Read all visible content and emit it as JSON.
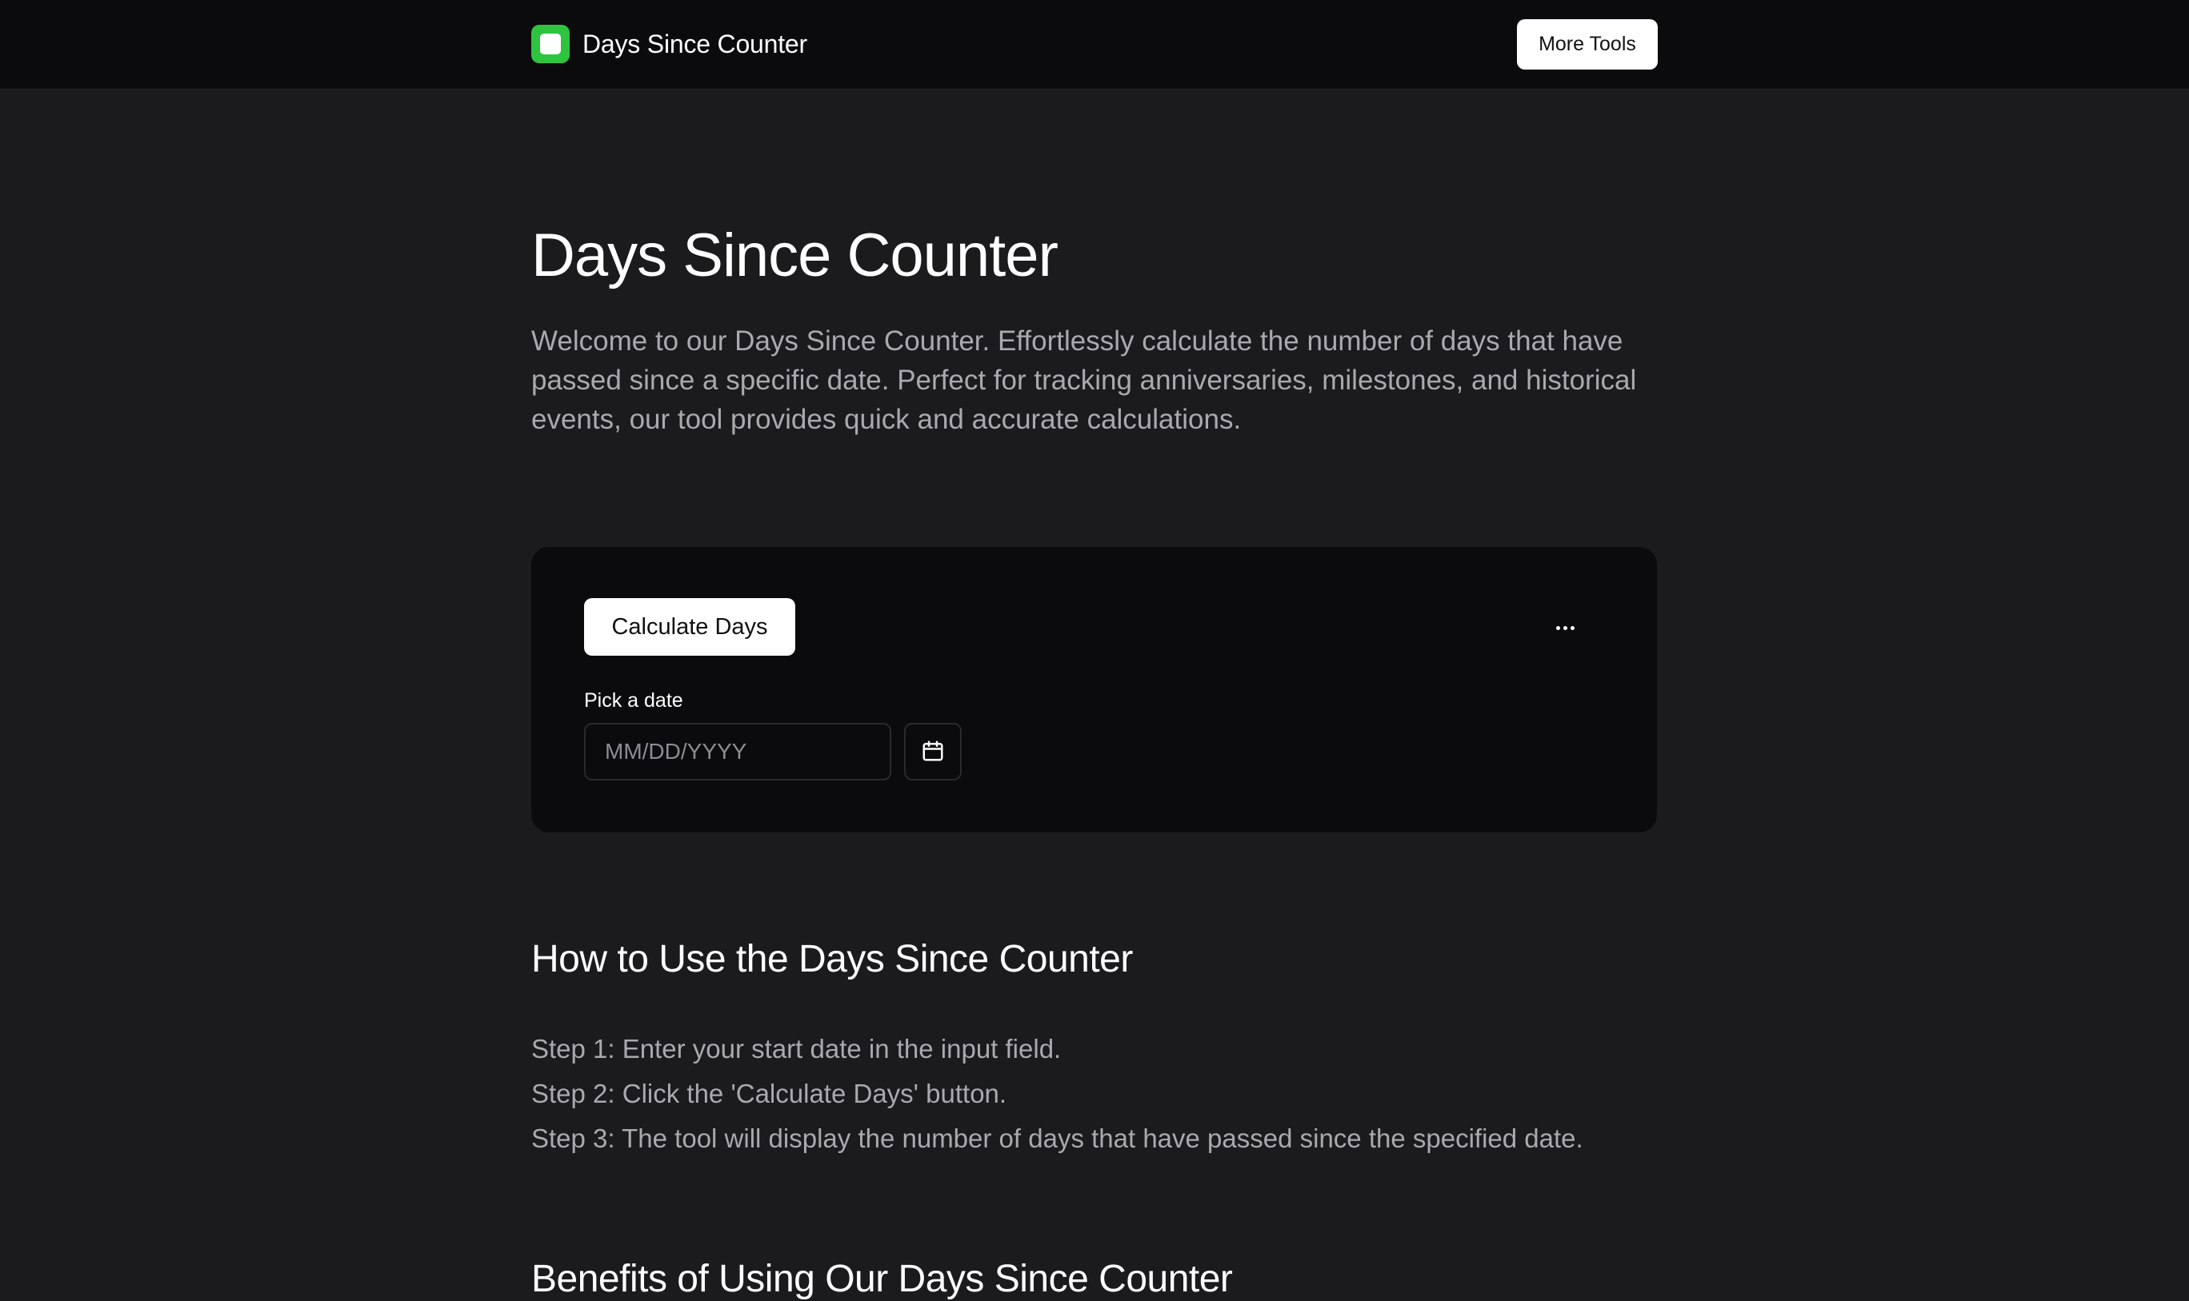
{
  "header": {
    "brand_name": "Days Since Counter",
    "logo_icon": "app-logo-icon",
    "more_tools_label": "More Tools"
  },
  "hero": {
    "title": "Days Since Counter",
    "intro": "Welcome to our Days Since Counter. Effortlessly calculate the number of days that have passed since a specific date. Perfect for tracking anniversaries, milestones, and historical events, our tool provides quick and accurate calculations."
  },
  "calculator": {
    "calculate_label": "Calculate Days",
    "more_icon": "more-horizontal-icon",
    "date_label": "Pick a date",
    "date_placeholder": "MM/DD/YYYY",
    "date_value": "",
    "calendar_icon": "calendar-icon"
  },
  "how_to": {
    "heading": "How to Use the Days Since Counter",
    "steps": [
      "Step 1: Enter your start date in the input field.",
      "Step 2: Click the 'Calculate Days' button.",
      "Step 3: The tool will display the number of days that have passed since the specified date."
    ]
  },
  "benefits": {
    "heading": "Benefits of Using Our Days Since Counter"
  },
  "colors": {
    "page_bg": "#1b1b1d",
    "header_bg": "#0b0b0d",
    "card_bg": "#0b0b0d",
    "accent_green": "#2fc43f",
    "muted_text": "#a9a9ae"
  }
}
